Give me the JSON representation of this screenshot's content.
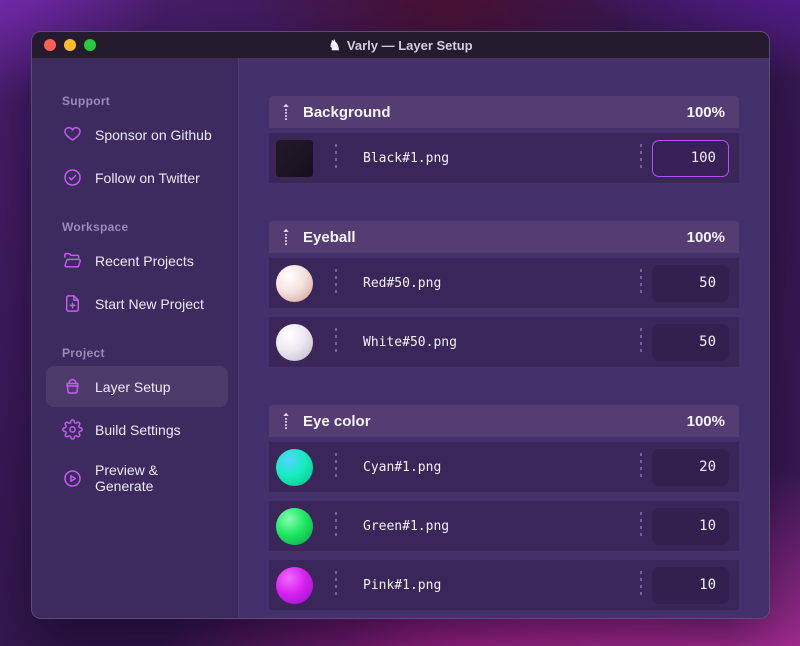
{
  "window": {
    "title": "Varly — Layer Setup",
    "app_icon": "unicorn-icon",
    "traffic_lights": [
      "#ff5f57",
      "#febc2e",
      "#28c840"
    ]
  },
  "colors": {
    "accent_icon": "#c55df2",
    "focus_border": "#ab57f0",
    "titlebar_bg": "#241b2d",
    "sidebar_bg": "#3d2a5e",
    "main_bg": "#44306a",
    "group_header_bg": "#543d72",
    "row_bg": "#3a2658"
  },
  "sidebar": {
    "sections": [
      {
        "label": "Support",
        "items": [
          {
            "label": "Sponsor on Github",
            "icon": "heart-icon",
            "active": false
          },
          {
            "label": "Follow on Twitter",
            "icon": "verified-badge-icon",
            "active": false
          }
        ]
      },
      {
        "label": "Workspace",
        "items": [
          {
            "label": "Recent Projects",
            "icon": "folder-open-icon",
            "active": false
          },
          {
            "label": "Start New Project",
            "icon": "file-plus-icon",
            "active": false
          }
        ]
      },
      {
        "label": "Project",
        "items": [
          {
            "label": "Layer Setup",
            "icon": "layer-box-icon",
            "active": true
          },
          {
            "label": "Build Settings",
            "icon": "gear-icon",
            "active": false
          },
          {
            "label": "Preview & Generate",
            "icon": "play-circle-icon",
            "active": false
          }
        ]
      }
    ]
  },
  "main": {
    "groups": [
      {
        "name": "Background",
        "opacity_label": "100%",
        "layers": [
          {
            "file": "Black#1.png",
            "value": "100",
            "focused": true,
            "thumb": {
              "shape": "square",
              "gradient": [
                "#221a29",
                "#170f1d"
              ]
            }
          }
        ]
      },
      {
        "name": "Eyeball",
        "opacity_label": "100%",
        "layers": [
          {
            "file": "Red#50.png",
            "value": "50",
            "focused": false,
            "thumb": {
              "shape": "circle",
              "gradient": [
                "#ffffff",
                "#f6e2dd",
                "#c89d93"
              ]
            }
          },
          {
            "file": "White#50.png",
            "value": "50",
            "focused": false,
            "thumb": {
              "shape": "circle",
              "gradient": [
                "#ffffff",
                "#ece9f1",
                "#b9b4c6"
              ]
            }
          }
        ]
      },
      {
        "name": "Eye color",
        "opacity_label": "100%",
        "layers": [
          {
            "file": "Cyan#1.png",
            "value": "20",
            "focused": false,
            "thumb": {
              "shape": "circle",
              "gradient": [
                "#55d2ff",
                "#17ecc0",
                "#06c37e"
              ]
            }
          },
          {
            "file": "Green#1.png",
            "value": "10",
            "focused": false,
            "thumb": {
              "shape": "circle",
              "gradient": [
                "#86fcb4",
                "#1fe961",
                "#0a9e4a"
              ]
            }
          },
          {
            "file": "Pink#1.png",
            "value": "10",
            "focused": false,
            "thumb": {
              "shape": "circle",
              "gradient": [
                "#f06bff",
                "#d822ef",
                "#9012c9"
              ]
            }
          }
        ]
      }
    ]
  }
}
